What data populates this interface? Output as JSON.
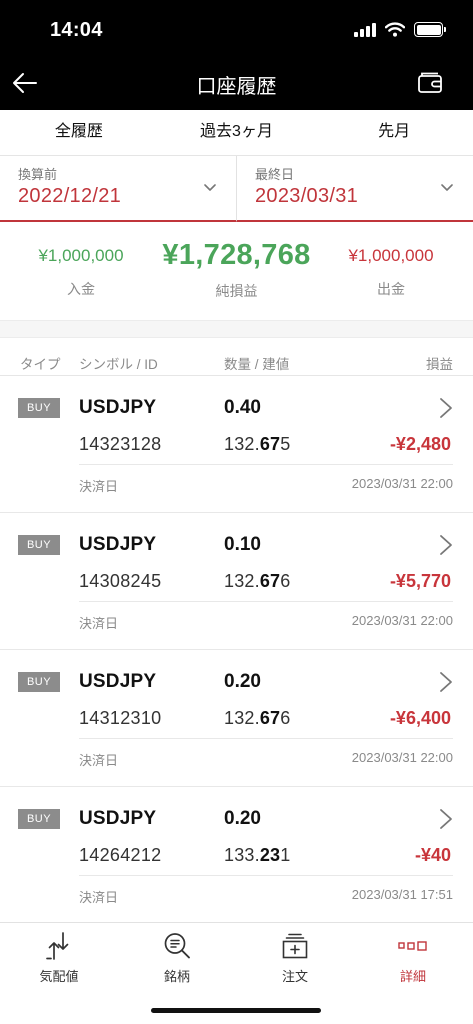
{
  "status_bar": {
    "time": "14:04"
  },
  "nav": {
    "title": "口座履歴"
  },
  "period_tabs": [
    {
      "label": "全履歴"
    },
    {
      "label": "過去3ヶ月"
    },
    {
      "label": "先月"
    }
  ],
  "date_range": {
    "from": {
      "caption": "換算前",
      "value": "2022/12/21"
    },
    "to": {
      "caption": "最終日",
      "value": "2023/03/31"
    }
  },
  "summary": {
    "deposit": {
      "value": "¥1,000,000",
      "label": "入金"
    },
    "net_pl": {
      "value": "¥1,728,768",
      "label": "純損益"
    },
    "withdrawal": {
      "value": "¥1,000,000",
      "label": "出金"
    }
  },
  "columns": {
    "type": "タイプ",
    "symbol_id": "シンボル / ID",
    "qty_price": "数量 / 建値",
    "pl": "損益"
  },
  "trades": [
    {
      "side": "BUY",
      "symbol": "USDJPY",
      "qty": "0.40",
      "id": "14323128",
      "price_head": "132.",
      "price_bold": "67",
      "price_tail": "5",
      "pl": "-¥2,480",
      "settle_label": "決済日",
      "settle_date": "2023/03/31 22:00"
    },
    {
      "side": "BUY",
      "symbol": "USDJPY",
      "qty": "0.10",
      "id": "14308245",
      "price_head": "132.",
      "price_bold": "67",
      "price_tail": "6",
      "pl": "-¥5,770",
      "settle_label": "決済日",
      "settle_date": "2023/03/31 22:00"
    },
    {
      "side": "BUY",
      "symbol": "USDJPY",
      "qty": "0.20",
      "id": "14312310",
      "price_head": "132.",
      "price_bold": "67",
      "price_tail": "6",
      "pl": "-¥6,400",
      "settle_label": "決済日",
      "settle_date": "2023/03/31 22:00"
    },
    {
      "side": "BUY",
      "symbol": "USDJPY",
      "qty": "0.20",
      "id": "14264212",
      "price_head": "133.",
      "price_bold": "23",
      "price_tail": "1",
      "pl": "-¥40",
      "settle_label": "決済日",
      "settle_date": "2023/03/31 17:51"
    }
  ],
  "tab_bar": [
    {
      "label": "気配値",
      "icon": "quote-arrows-icon"
    },
    {
      "label": "銘柄",
      "icon": "search-list-icon"
    },
    {
      "label": "注文",
      "icon": "order-icon"
    },
    {
      "label": "詳細",
      "icon": "detail-grid-icon"
    }
  ],
  "colors": {
    "accent": "#c0353b",
    "positive": "#4ba55a",
    "negative": "#c8353b",
    "badge": "#8c8c8c"
  }
}
